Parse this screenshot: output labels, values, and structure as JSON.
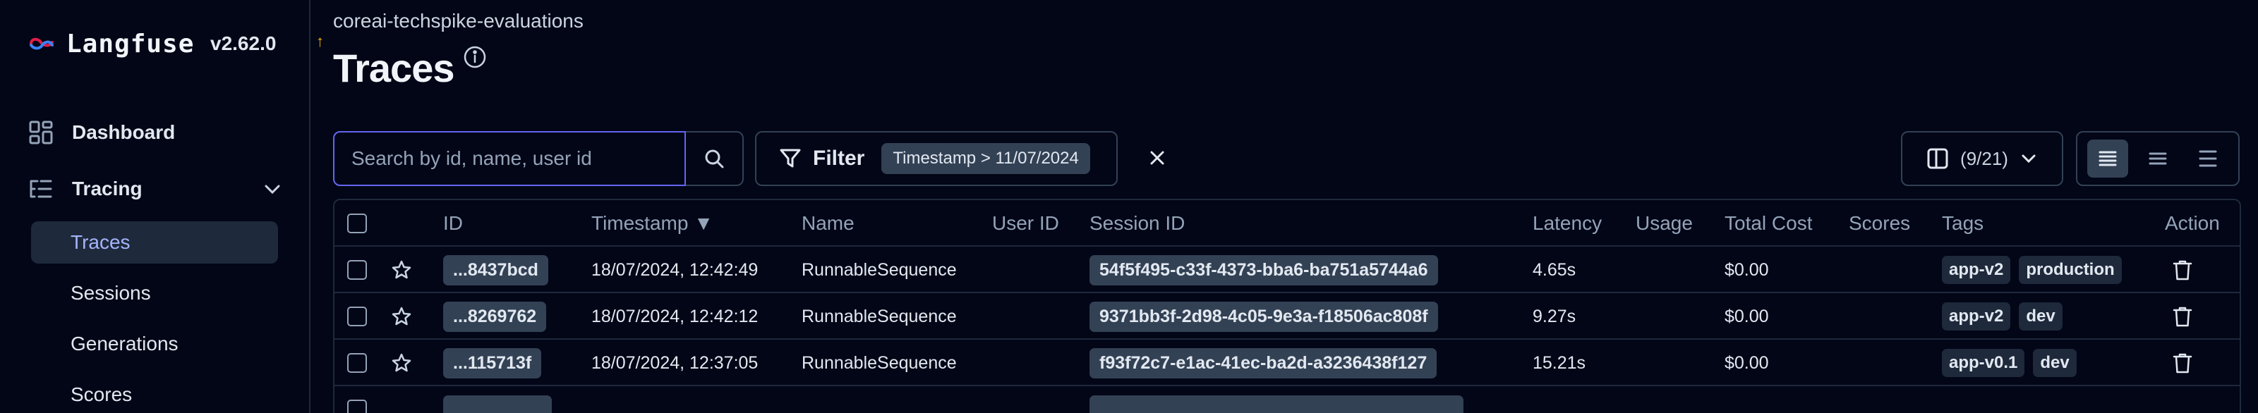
{
  "brand": {
    "name": "Langfuse",
    "version": "v2.62.0",
    "update_arrow": "↑"
  },
  "sidebar": {
    "items": [
      {
        "label": "Dashboard",
        "icon": "dashboard-icon"
      },
      {
        "label": "Tracing",
        "icon": "tracing-icon",
        "expanded": true
      }
    ],
    "sub_items": [
      {
        "label": "Traces",
        "active": true
      },
      {
        "label": "Sessions",
        "active": false
      },
      {
        "label": "Generations",
        "active": false
      },
      {
        "label": "Scores",
        "active": false
      }
    ]
  },
  "header": {
    "project": "coreai-techspike-evaluations",
    "title": "Traces"
  },
  "search": {
    "placeholder": "Search by id, name, user id",
    "value": ""
  },
  "filter": {
    "label": "Filter",
    "chip": "Timestamp > 11/07/2024"
  },
  "columns": {
    "label": "(9/21)"
  },
  "table": {
    "headers": {
      "id": "ID",
      "timestamp": "Timestamp ▼",
      "name": "Name",
      "user_id": "User ID",
      "session_id": "Session ID",
      "latency": "Latency",
      "usage": "Usage",
      "total_cost": "Total Cost",
      "scores": "Scores",
      "tags": "Tags",
      "action": "Action"
    },
    "rows": [
      {
        "id": "...8437bcd",
        "timestamp": "18/07/2024, 12:42:49",
        "name": "RunnableSequence",
        "session_id": "54f5f495-c33f-4373-bba6-ba751a5744a6",
        "latency": "4.65s",
        "total_cost": "$0.00",
        "tags": [
          "app-v2",
          "production"
        ]
      },
      {
        "id": "...8269762",
        "timestamp": "18/07/2024, 12:42:12",
        "name": "RunnableSequence",
        "session_id": "9371bb3f-2d98-4c05-9e3a-f18506ac808f",
        "latency": "9.27s",
        "total_cost": "$0.00",
        "tags": [
          "app-v2",
          "dev"
        ]
      },
      {
        "id": "...115713f",
        "timestamp": "18/07/2024, 12:37:05",
        "name": "RunnableSequence",
        "session_id": "f93f72c7-e1ac-41ec-ba2d-a3236438f127",
        "latency": "15.21s",
        "total_cost": "$0.00",
        "tags": [
          "app-v0.1",
          "dev"
        ]
      }
    ]
  },
  "colors": {
    "background": "#020617",
    "border": "#1e293b",
    "accent": "#6366f1",
    "active_text": "#a5b4fc",
    "brand_logo": "#e11d48"
  }
}
